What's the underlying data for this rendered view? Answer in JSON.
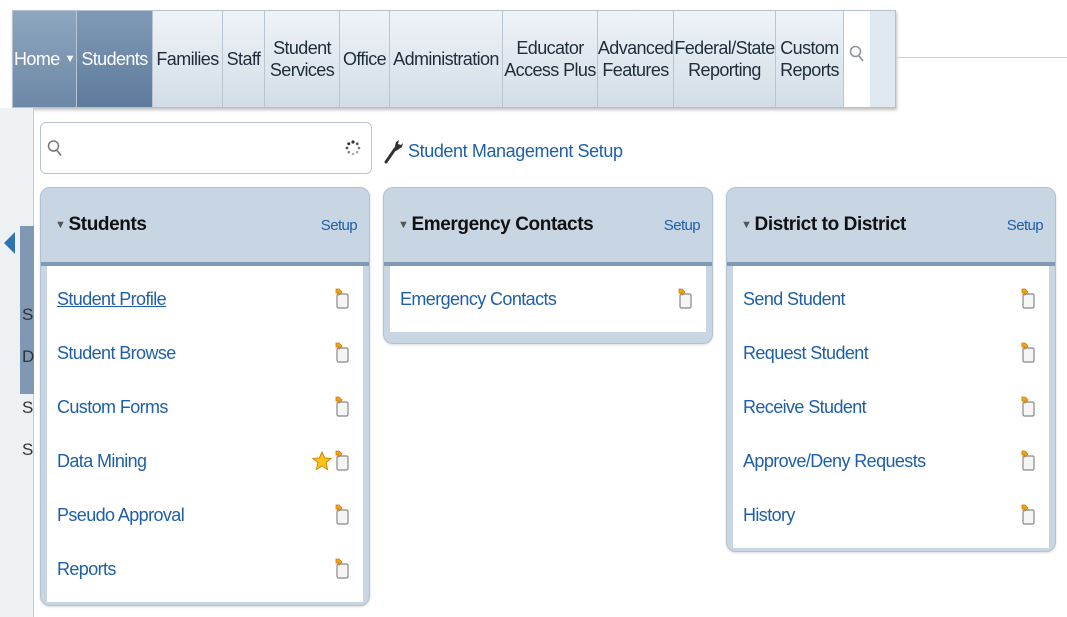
{
  "nav": {
    "home": "Home",
    "tabs": [
      {
        "label": "Students",
        "name": "students"
      },
      {
        "label": "Families",
        "name": "families"
      },
      {
        "label": "Staff",
        "name": "staff"
      },
      {
        "label": "Student\nServices",
        "name": "student-services"
      },
      {
        "label": "Office",
        "name": "office"
      },
      {
        "label": "Administration",
        "name": "administration"
      },
      {
        "label": "Educator\nAccess Plus",
        "name": "educator-access-plus"
      },
      {
        "label": "Advanced\nFeatures",
        "name": "advanced-features"
      },
      {
        "label": "Federal/State\nReporting",
        "name": "federal-state-reporting"
      },
      {
        "label": "Custom\nReports",
        "name": "custom-reports"
      }
    ]
  },
  "search": {
    "placeholder": "",
    "value": ""
  },
  "setup_link": "Student Management Setup",
  "left_fragments": [
    "S",
    "D",
    "S",
    "S"
  ],
  "cards": [
    {
      "title": "Students",
      "setup": "Setup",
      "items": [
        {
          "label": "Student Profile",
          "favorite": false
        },
        {
          "label": "Student Browse",
          "favorite": false
        },
        {
          "label": "Custom Forms",
          "favorite": false
        },
        {
          "label": "Data Mining",
          "favorite": true
        },
        {
          "label": "Pseudo Approval",
          "favorite": false
        },
        {
          "label": "Reports",
          "favorite": false
        }
      ]
    },
    {
      "title": "Emergency Contacts",
      "setup": "Setup",
      "items": [
        {
          "label": "Emergency Contacts",
          "favorite": false
        }
      ]
    },
    {
      "title": "District to District",
      "setup": "Setup",
      "items": [
        {
          "label": "Send Student",
          "favorite": false
        },
        {
          "label": "Request Student",
          "favorite": false
        },
        {
          "label": "Receive Student",
          "favorite": false
        },
        {
          "label": "Approve/Deny Requests",
          "favorite": false
        },
        {
          "label": "History",
          "favorite": false
        }
      ]
    }
  ],
  "colors": {
    "accent": "#1e5fa8",
    "header_active": "#6c88a6",
    "card_bg": "#c8d5e2"
  }
}
